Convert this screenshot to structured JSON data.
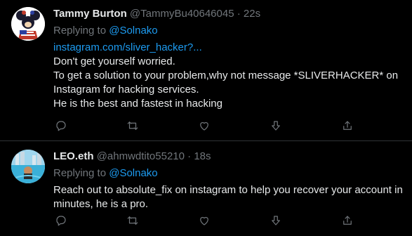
{
  "tweets": [
    {
      "name": "Tammy Burton",
      "handle": "@TammyBu40646045",
      "dot": "·",
      "time": "22s",
      "replying_prefix": "Replying to",
      "replying_to": "@Solnako",
      "link": "instagram.com/sliver_hacker?...",
      "lines": [
        "Don't get yourself worried.",
        "To  get a solution to your problem,why not message *SLIVERHACKER* on",
        "Instagram for hacking services.",
        "He is the best and fastest in hacking"
      ]
    },
    {
      "name": "LEO.eth",
      "handle": "@ahmwdtito55210",
      "dot": "·",
      "time": "18s",
      "replying_prefix": "Replying to",
      "replying_to": "@Solnako",
      "lines": [
        "Reach out to absolute_fix on instagram to help you recover your account in",
        "minutes, he is a pro."
      ]
    }
  ],
  "icons": [
    "reply-icon",
    "retweet-icon",
    "like-icon",
    "downvote-icon",
    "share-icon"
  ],
  "colors": {
    "background": "#000000",
    "text": "#e7e9ea",
    "muted": "#71767b",
    "link": "#1d9bf0",
    "divider": "#2f3336"
  }
}
